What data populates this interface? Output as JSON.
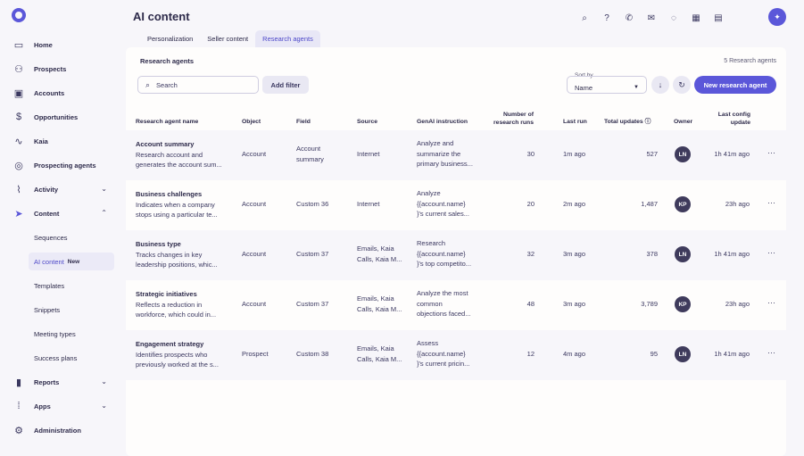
{
  "sidebar": {
    "items": [
      {
        "label": "Home",
        "icon": "home-icon",
        "glyph": "▭"
      },
      {
        "label": "Prospects",
        "icon": "users-icon",
        "glyph": "⚇"
      },
      {
        "label": "Accounts",
        "icon": "briefcase-icon",
        "glyph": "▣"
      },
      {
        "label": "Opportunities",
        "icon": "dollar-icon",
        "glyph": "$"
      },
      {
        "label": "Kaia",
        "icon": "waveform-icon",
        "glyph": "∿"
      },
      {
        "label": "Prospecting agents",
        "icon": "agent-icon",
        "glyph": "◎"
      },
      {
        "label": "Activity",
        "icon": "activity-icon",
        "glyph": "⌇"
      },
      {
        "label": "Content",
        "icon": "send-icon",
        "glyph": "➤"
      }
    ],
    "content_sub": [
      "Sequences",
      "AI content",
      "Templates",
      "Snippets",
      "Meeting types",
      "Success plans"
    ],
    "new_badge": "New",
    "bottom_items": [
      {
        "label": "Reports",
        "icon": "bar-chart-icon",
        "glyph": "▮"
      },
      {
        "label": "Apps",
        "icon": "grid-icon",
        "glyph": "⁞"
      },
      {
        "label": "Administration",
        "icon": "gear-icon",
        "glyph": "⚙"
      }
    ]
  },
  "header": {
    "title": "AI content",
    "avatar_glyph": "✦",
    "icons": [
      {
        "name": "search-icon",
        "glyph": "⌕"
      },
      {
        "name": "help-icon",
        "glyph": "?"
      },
      {
        "name": "phone-icon",
        "glyph": "✆"
      },
      {
        "name": "mail-icon",
        "glyph": "✉"
      },
      {
        "name": "chat-icon",
        "glyph": "◌"
      },
      {
        "name": "calendar-icon",
        "glyph": "▦"
      },
      {
        "name": "image-icon",
        "glyph": "▤"
      }
    ]
  },
  "tabs": [
    "Personalization",
    "Seller content",
    "Research agents"
  ],
  "panel": {
    "title": "Research agents",
    "count": "5 Research agents",
    "search_placeholder": "Search",
    "add_filter": "Add filter",
    "sort_label": "Sort by",
    "sort_value": "Name",
    "new_button": "New research agent"
  },
  "table": {
    "headers": {
      "name": "Research agent name",
      "object": "Object",
      "field": "Field",
      "source": "Source",
      "instruction": "GenAI instruction",
      "runs_1": "Number of",
      "runs_2": "research runs",
      "last_run": "Last  run",
      "total_updates": "Total updates",
      "owner": "Owner",
      "config_1": "Last  config",
      "config_2": "update"
    },
    "rows": [
      {
        "name": "Account summary",
        "desc1": "Research account and",
        "desc2": "generates the account sum...",
        "object": "Account",
        "field1": "Account",
        "field2": "summary",
        "source1": "Internet",
        "source2": "",
        "instr1": "Analyze and",
        "instr2": "summarize the",
        "instr3": "primary business...",
        "runs": "30",
        "last_run": "1m ago",
        "updates": "527",
        "owner": "LN",
        "config": "1h 41m ago"
      },
      {
        "name": "Business challenges",
        "desc1": "Indicates when a company",
        "desc2": "stops using a particular te...",
        "object": "Account",
        "field1": "Custom 36",
        "field2": "",
        "source1": "Internet",
        "source2": "",
        "instr1": "Analyze",
        "instr2": "{{account.name}",
        "instr3": "}'s current sales...",
        "runs": "20",
        "last_run": "2m ago",
        "updates": "1,487",
        "owner": "KP",
        "config": "23h ago"
      },
      {
        "name": "Business type",
        "desc1": "Tracks changes in key",
        "desc2": "leadership positions, whic...",
        "object": "Account",
        "field1": "Custom 37",
        "field2": "",
        "source1": "Emails, Kaia",
        "source2": "Calls, Kaia M...",
        "instr1": "Research",
        "instr2": "{{account.name}",
        "instr3": "}'s top competito...",
        "runs": "32",
        "last_run": "3m ago",
        "updates": "378",
        "owner": "LN",
        "config": "1h 41m ago"
      },
      {
        "name": "Strategic initiatives",
        "desc1": "Reflects a reduction in",
        "desc2": "workforce, which could in...",
        "object": "Account",
        "field1": "Custom 37",
        "field2": "",
        "source1": "Emails, Kaia",
        "source2": "Calls, Kaia M...",
        "instr1": "Analyze the most",
        "instr2": "common",
        "instr3": "objections faced...",
        "runs": "48",
        "last_run": "3m ago",
        "updates": "3,789",
        "owner": "KP",
        "config": "23h ago"
      },
      {
        "name": "Engagement strategy",
        "desc1": "Identifies prospects who",
        "desc2": "previously worked at the s...",
        "object": "Prospect",
        "field1": "Custom 38",
        "field2": "",
        "source1": "Emails, Kaia",
        "source2": "Calls, Kaia M...",
        "instr1": "Assess",
        "instr2": "{{account.name}",
        "instr3": "}'s current pricin...",
        "runs": "12",
        "last_run": "4m ago",
        "updates": "95",
        "owner": "LN",
        "config": "1h 41m ago"
      }
    ],
    "more_glyph": "···"
  },
  "colors": {
    "accent": "#5b57d9",
    "active_bg": "#ebeaf7",
    "avatar": "#3f3b5c"
  }
}
